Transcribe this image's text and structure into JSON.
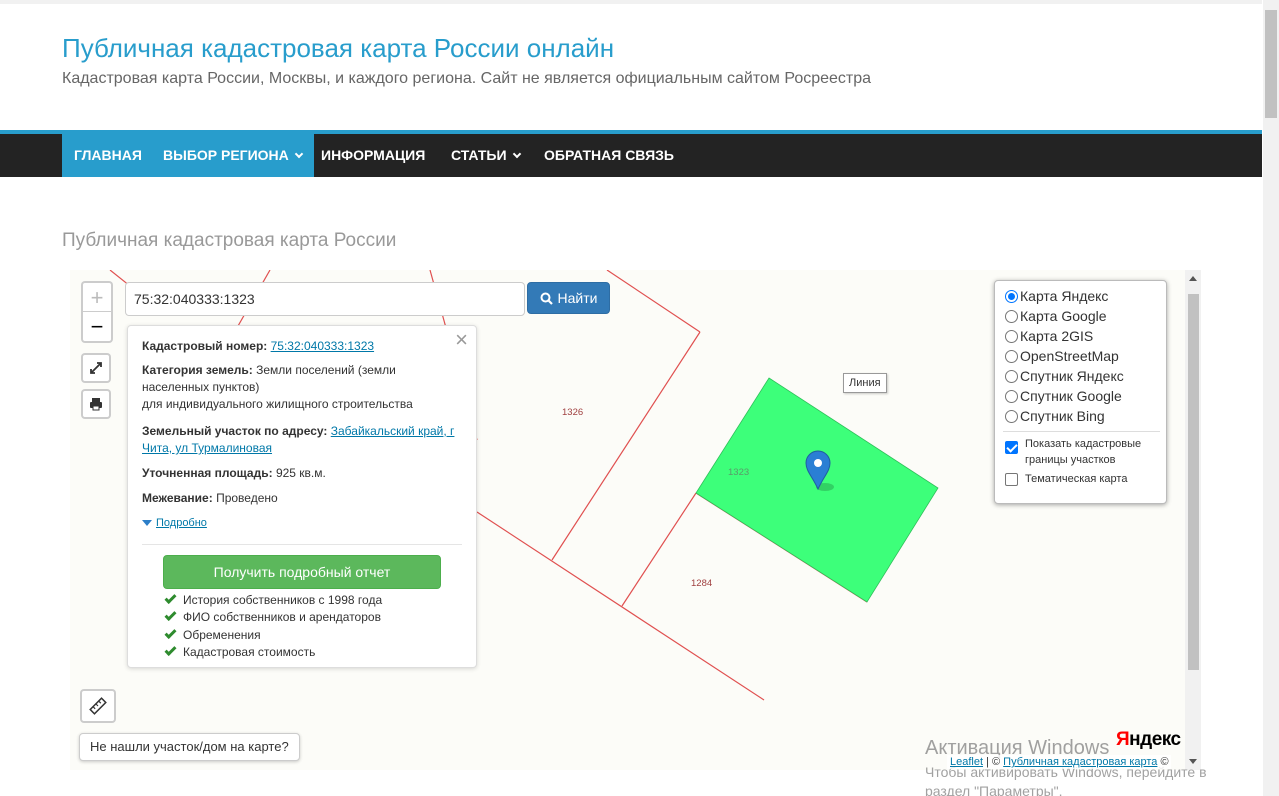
{
  "header": {
    "title": "Публичная кадастровая карта России онлайн",
    "description": "Кадастровая карта России, Москвы, и каждого региона. Сайт не является официальным сайтом Росреестра"
  },
  "nav": {
    "items": [
      {
        "label": "ГЛАВНАЯ",
        "active": true
      },
      {
        "label": "ВЫБОР РЕГИОНА",
        "dropdown": true
      },
      {
        "label": "ИНФОРМАЦИЯ"
      },
      {
        "label": "СТАТЬИ",
        "dropdown": true
      },
      {
        "label": "ОБРАТНАЯ СВЯЗЬ"
      }
    ]
  },
  "page": {
    "title": "Публичная кадастровая карта России"
  },
  "map": {
    "search": {
      "value": "75:32:040333:1323",
      "button_label": "Найти"
    },
    "zoom": {
      "in": "+",
      "out": "−"
    },
    "parcel_labels": {
      "p1326": "1326",
      "p1323": "1323",
      "p1284": "1284"
    },
    "tooltip": "Линия",
    "not_found_label": "Не нашли участок/дом на карте?",
    "yandex_logo": {
      "y": "Я",
      "rest": "ндекс"
    },
    "attribution": {
      "leaflet": "Leaflet",
      "sep": " | © ",
      "site": "Публичная кадастровая карта",
      "end": " ©"
    }
  },
  "popup": {
    "cad_number_label": "Кадастровый номер:",
    "cad_number": "75:32:040333:1323",
    "category_label": "Категория земель:",
    "category_value": "Земли поселений (земли населенных пунктов)",
    "category_use": "для индивидуального жилищного строительства",
    "address_label": "Земельный участок по адресу:",
    "address_value": "Забайкальский край, г Чита, ул Турмалиновая",
    "area_label": "Уточненная площадь:",
    "area_value": "925 кв.м.",
    "survey_label": "Межевание:",
    "survey_value": "Проведено",
    "more_label": "Подробно",
    "report_button": "Получить подробный отчет",
    "checks": [
      "История собственников с 1998 года",
      "ФИО собственников и арендаторов",
      "Обременения",
      "Кадастровая стоимость"
    ]
  },
  "layers": {
    "base": [
      {
        "label": "Карта Яндекс",
        "selected": true
      },
      {
        "label": "Карта Google"
      },
      {
        "label": "Карта 2GIS"
      },
      {
        "label": "OpenStreetMap"
      },
      {
        "label": "Спутник Яндекс"
      },
      {
        "label": "Спутник Google"
      },
      {
        "label": "Спутник Bing"
      }
    ],
    "overlay_cadastral": "Показать кадастровые границы участков",
    "overlay_cadastral_checked": true,
    "overlay_thematic": "Тематическая карта",
    "overlay_thematic_checked": false
  },
  "watermark": {
    "line1": "Активация Windows",
    "line2": "Чтобы активировать Windows, перейдите в",
    "line3": "раздел \"Параметры\"."
  },
  "colors": {
    "accent": "#289dcc",
    "nav_bg": "#232323",
    "parcel_fill": "#3dff7a",
    "parcel_line": "#e05050",
    "marker": "#2a7fd4"
  }
}
